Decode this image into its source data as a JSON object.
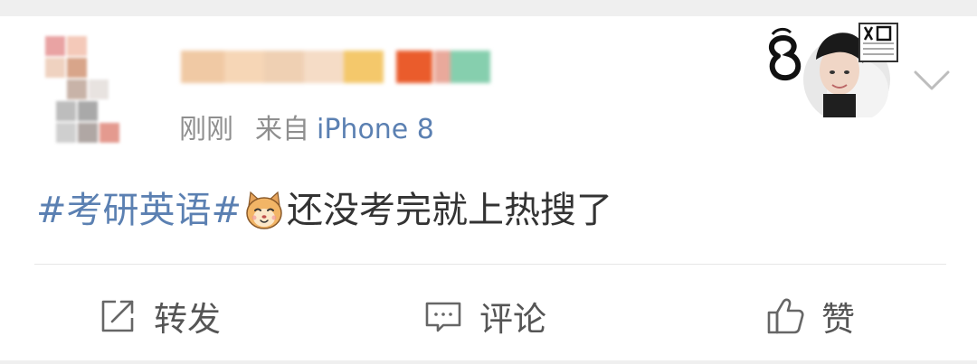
{
  "post": {
    "meta": {
      "time": "刚刚",
      "source_prefix": "来自",
      "device": "iPhone 8"
    },
    "content": {
      "hashtag": "#考研英语#",
      "text": "还没考完就上热搜了",
      "emoji_icon": "cat-face-emoji"
    }
  },
  "actions": {
    "repost_label": "转发",
    "comment_label": "评论",
    "like_label": "赞"
  },
  "colors": {
    "link": "#5b80b2",
    "meta_gray": "#8f8f8f",
    "body_text": "#333333"
  }
}
